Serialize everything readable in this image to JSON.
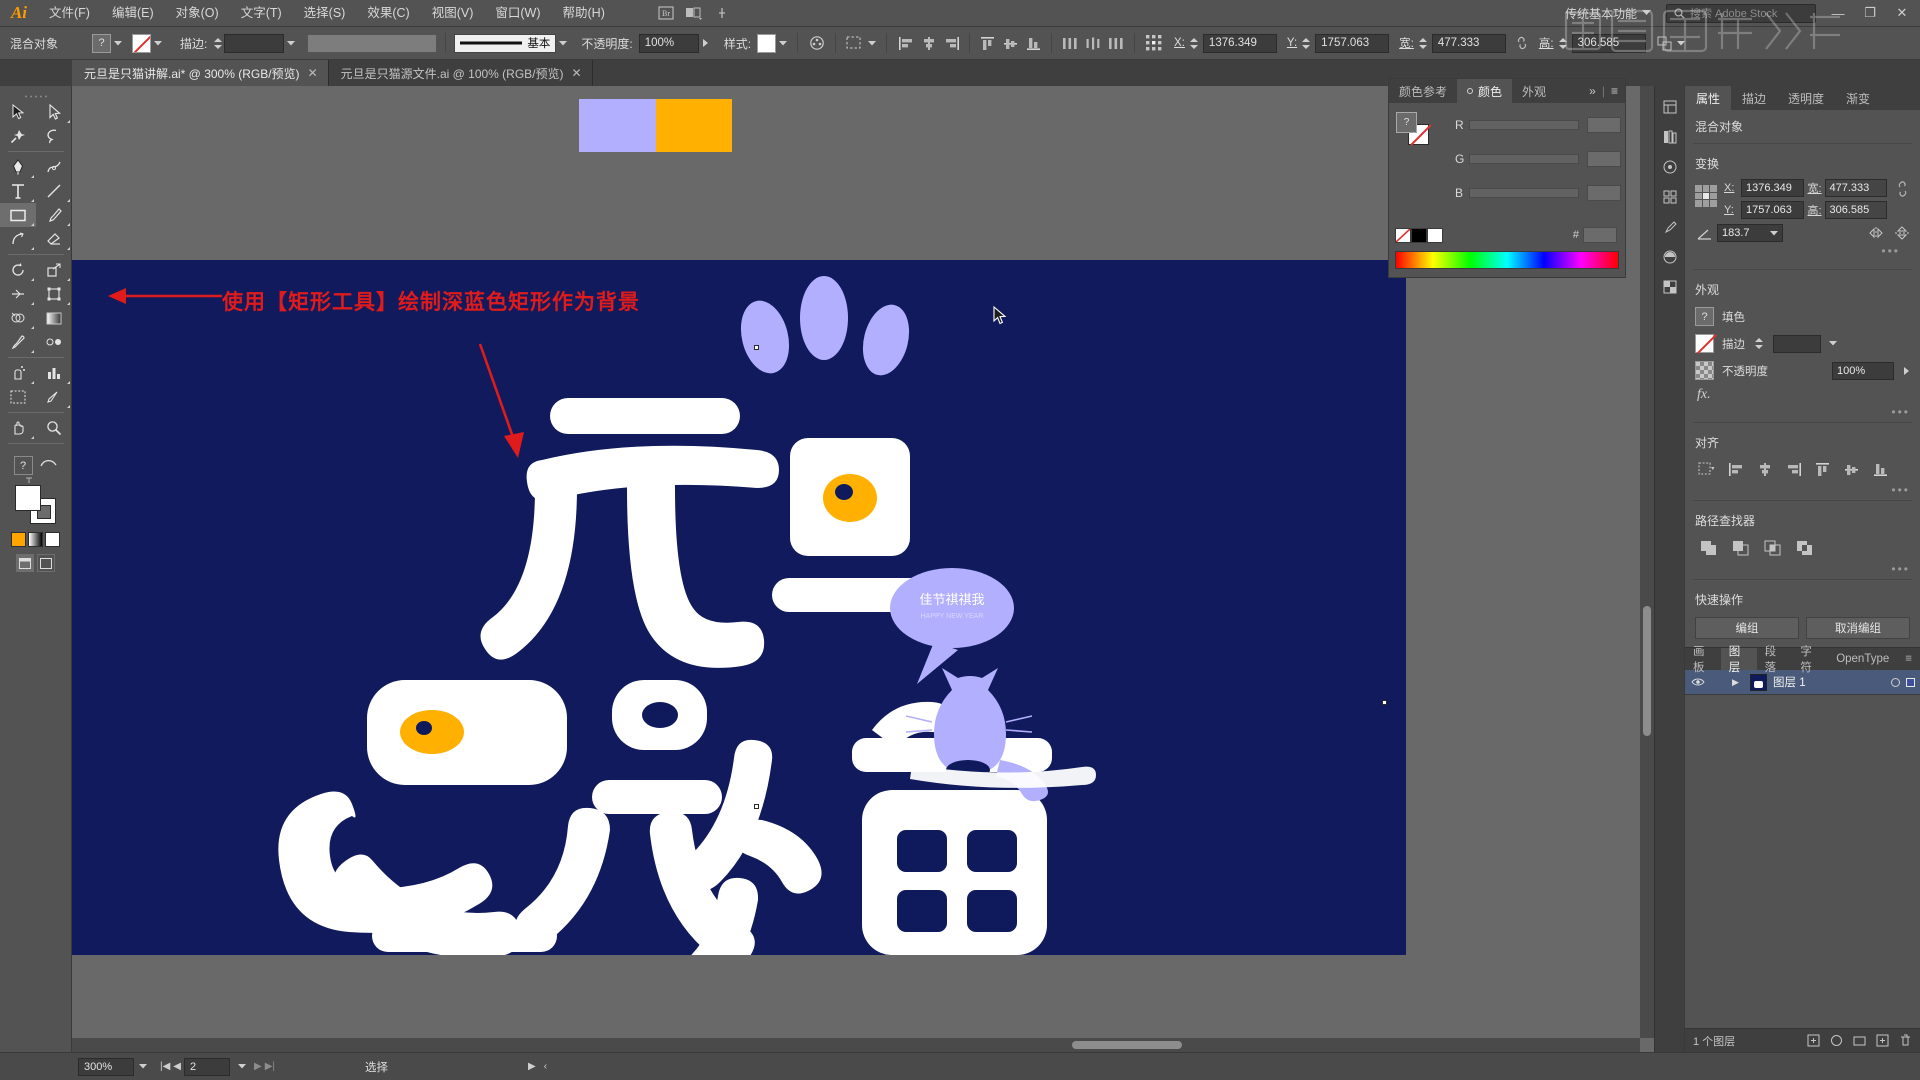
{
  "app": {
    "name": "Adobe Illustrator",
    "logo": "Ai"
  },
  "menubar": {
    "items": [
      {
        "label": "文件(F)"
      },
      {
        "label": "编辑(E)"
      },
      {
        "label": "对象(O)"
      },
      {
        "label": "文字(T)"
      },
      {
        "label": "选择(S)"
      },
      {
        "label": "效果(C)"
      },
      {
        "label": "视图(V)"
      },
      {
        "label": "窗口(W)"
      },
      {
        "label": "帮助(H)"
      }
    ],
    "workspace": "传统基本功能",
    "stock_placeholder": "搜索 Adobe Stock",
    "window_minimize": "—",
    "window_restore": "❐",
    "window_close": "✕"
  },
  "controlbar": {
    "object_label": "混合对象",
    "fill_swatch_label": "?",
    "stroke_label": "描边:",
    "stroke_weight": "",
    "stroke_profile": "基本",
    "opacity_label": "不透明度:",
    "opacity_value": "100%",
    "style_label": "样式:",
    "x_label": "X:",
    "x_value": "1376.349",
    "y_label": "Y:",
    "y_value": "1757.063",
    "w_label": "宽:",
    "w_value": "477.333",
    "h_label": "高:",
    "h_value": "306.585"
  },
  "tabs": [
    {
      "title": "元旦是只猫讲解.ai* @ 300% (RGB/预览)",
      "active": true,
      "close": "✕"
    },
    {
      "title": "元旦是只猫源文件.ai @ 100% (RGB/预览)",
      "active": false,
      "close": "✕"
    }
  ],
  "toolbar": {
    "tools": [
      {
        "name": "selection-tool",
        "row": 0,
        "col": 0
      },
      {
        "name": "direct-selection-tool",
        "row": 0,
        "col": 1
      },
      {
        "name": "magic-wand-tool",
        "row": 1,
        "col": 0
      },
      {
        "name": "lasso-tool",
        "row": 1,
        "col": 1
      },
      {
        "name": "pen-tool",
        "row": 2,
        "col": 0
      },
      {
        "name": "curvature-tool",
        "row": 2,
        "col": 1
      },
      {
        "name": "type-tool",
        "row": 3,
        "col": 0
      },
      {
        "name": "line-segment-tool",
        "row": 3,
        "col": 1
      },
      {
        "name": "rectangle-tool",
        "row": 4,
        "col": 0
      },
      {
        "name": "paintbrush-tool",
        "row": 4,
        "col": 1
      },
      {
        "name": "shaper-tool",
        "row": 5,
        "col": 0
      },
      {
        "name": "eraser-tool",
        "row": 5,
        "col": 1
      },
      {
        "name": "rotate-tool",
        "row": 6,
        "col": 0
      },
      {
        "name": "scale-tool",
        "row": 6,
        "col": 1
      },
      {
        "name": "width-tool",
        "row": 7,
        "col": 0
      },
      {
        "name": "free-transform-tool",
        "row": 7,
        "col": 1
      },
      {
        "name": "shape-builder-tool",
        "row": 8,
        "col": 0
      },
      {
        "name": "gradient-tool",
        "row": 8,
        "col": 1
      },
      {
        "name": "eyedropper-tool",
        "row": 9,
        "col": 0
      },
      {
        "name": "blend-tool",
        "row": 9,
        "col": 1
      },
      {
        "name": "symbol-sprayer-tool",
        "row": 10,
        "col": 0
      },
      {
        "name": "column-graph-tool",
        "row": 10,
        "col": 1
      },
      {
        "name": "artboard-tool",
        "row": 11,
        "col": 0
      },
      {
        "name": "slice-tool",
        "row": 11,
        "col": 1
      },
      {
        "name": "hand-tool",
        "row": 12,
        "col": 0
      },
      {
        "name": "zoom-tool",
        "row": 12,
        "col": 1
      }
    ],
    "selected_tool": "rectangle-tool",
    "help_label": "?",
    "fill_color": "#ffffff",
    "stroke_color": "#ffffff"
  },
  "canvas": {
    "annotation_text": "使用【矩形工具】绘制深蓝色矩形作为背景",
    "annotation_color": "#e01b1b",
    "background_color": "#101a5c",
    "swatch_purple": "#b3afff",
    "swatch_orange": "#ffb000",
    "artwork_title": "元旦是只猫",
    "bubble_text": "佳节祺祺我",
    "artwork_white": "#ffffff"
  },
  "color_panel": {
    "tabs": [
      {
        "label": "颜色参考",
        "active": false
      },
      {
        "label": "颜色",
        "active": true
      },
      {
        "label": "外观",
        "active": false
      }
    ],
    "channels": [
      {
        "label": "R",
        "value": ""
      },
      {
        "label": "G",
        "value": ""
      },
      {
        "label": "B",
        "value": ""
      }
    ],
    "hex_label": "#",
    "hex_value": "",
    "expand": "»",
    "menu": "≡"
  },
  "properties": {
    "tabs": [
      {
        "label": "属性",
        "active": true
      },
      {
        "label": "描边",
        "active": false
      },
      {
        "label": "透明度",
        "active": false
      },
      {
        "label": "渐变",
        "active": false
      }
    ],
    "object_type": "混合对象",
    "transform": {
      "title": "变换",
      "x_label": "X:",
      "x_value": "1376.349",
      "y_label": "Y:",
      "y_value": "1757.063",
      "w_label": "宽:",
      "w_value": "477.333",
      "h_label": "高:",
      "h_value": "306.585",
      "angle_label": "∠:",
      "angle_value": "183.7",
      "more": "•••"
    },
    "appearance": {
      "title": "外观",
      "fill_label": "填色",
      "fill_swatch": "?",
      "stroke_label": "描边",
      "stroke_value": "",
      "opacity_label": "不透明度",
      "opacity_value": "100%",
      "fx_label": "fx.",
      "more": "•••"
    },
    "align": {
      "title": "对齐",
      "more": "•••"
    },
    "pathfinder": {
      "title": "路径查找器",
      "more": "•••"
    },
    "quick_actions": {
      "title": "快速操作",
      "group_label": "编组",
      "ungroup_label": "取消编组"
    }
  },
  "layers_panel": {
    "tabs": [
      {
        "label": "画板",
        "active": false
      },
      {
        "label": "图层",
        "active": true
      },
      {
        "label": "段落",
        "active": false
      },
      {
        "label": "字符",
        "active": false
      },
      {
        "label": "OpenType",
        "active": false
      }
    ],
    "menu": "≡",
    "rows": [
      {
        "name": "图层 1",
        "visible": true,
        "selected": true
      }
    ],
    "footer_count": "1 个图层"
  },
  "statusbar": {
    "zoom": "300%",
    "page": "2",
    "status_text": "选择",
    "first": "|◀",
    "prev": "◀",
    "next": "▶",
    "last": "▶|"
  }
}
